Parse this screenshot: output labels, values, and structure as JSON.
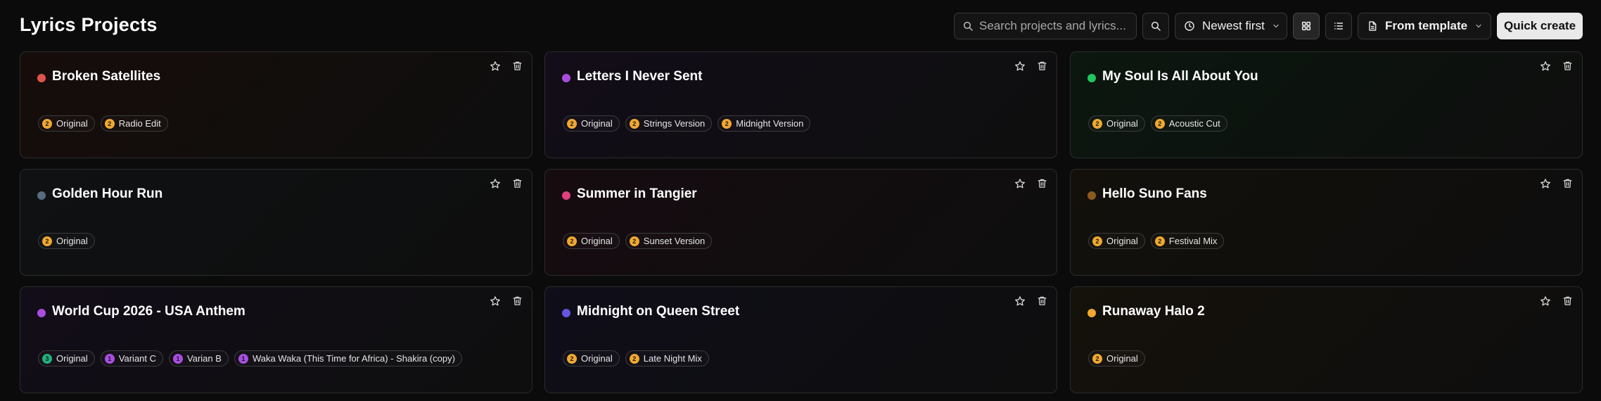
{
  "header": {
    "title": "Lyrics Projects",
    "search_placeholder": "Search projects and lyrics...",
    "search_icon": "search-icon",
    "search_button_icon": "search-icon",
    "sort_label": "Newest first",
    "sort_icon": "clock-icon",
    "view_grid_icon": "grid-icon",
    "view_list_icon": "list-icon",
    "view_mode": "grid",
    "template_label": "From template",
    "template_icon": "document-icon",
    "quick_create_label": "Quick create"
  },
  "colors": {
    "background": "#0b0b0b",
    "quick_create_bg": "#e9e9e9",
    "version_count_default": "#f0a830"
  },
  "projects": [
    {
      "title": "Broken Satellites",
      "dot_color": "#e0534d",
      "tint": "#160d0b",
      "versions": [
        {
          "label": "Original",
          "count": "2",
          "color": "#f0a830"
        },
        {
          "label": "Radio Edit",
          "count": "2",
          "color": "#f0a830"
        }
      ]
    },
    {
      "title": "Letters I Never Sent",
      "dot_color": "#a94de0",
      "tint": "#120d18",
      "versions": [
        {
          "label": "Original",
          "count": "2",
          "color": "#f0a830"
        },
        {
          "label": "Strings Version",
          "count": "2",
          "color": "#f0a830"
        },
        {
          "label": "Midnight Version",
          "count": "2",
          "color": "#f0a830"
        }
      ]
    },
    {
      "title": "My Soul Is All About You",
      "dot_color": "#22c55e",
      "tint": "#0b170f",
      "versions": [
        {
          "label": "Original",
          "count": "2",
          "color": "#f0a830"
        },
        {
          "label": "Acoustic Cut",
          "count": "2",
          "color": "#f0a830"
        }
      ]
    },
    {
      "title": "Golden Hour Run",
      "dot_color": "#5a6b7d",
      "tint": "#0f1113",
      "versions": [
        {
          "label": "Original",
          "count": "2",
          "color": "#f0a830"
        }
      ]
    },
    {
      "title": "Summer in Tangier",
      "dot_color": "#e0407f",
      "tint": "#160c10",
      "versions": [
        {
          "label": "Original",
          "count": "2",
          "color": "#f0a830"
        },
        {
          "label": "Sunset Version",
          "count": "2",
          "color": "#f0a830"
        }
      ]
    },
    {
      "title": "Hello Suno Fans",
      "dot_color": "#8b5a1e",
      "tint": "#13100b",
      "versions": [
        {
          "label": "Original",
          "count": "2",
          "color": "#f0a830"
        },
        {
          "label": "Festival Mix",
          "count": "2",
          "color": "#f0a830"
        }
      ]
    },
    {
      "title": "World Cup 2026 - USA Anthem",
      "dot_color": "#a94de0",
      "tint": "#120d18",
      "versions": [
        {
          "label": "Original",
          "count": "3",
          "color": "#22b07d"
        },
        {
          "label": "Variant C",
          "count": "1",
          "color": "#a94de0"
        },
        {
          "label": "Varian B",
          "count": "1",
          "color": "#a94de0"
        },
        {
          "label": "Waka Waka (This Time for Africa) - Shakira (copy)",
          "count": "1",
          "color": "#a94de0"
        }
      ]
    },
    {
      "title": "Midnight on Queen Street",
      "dot_color": "#6655e0",
      "tint": "#0f0e19",
      "versions": [
        {
          "label": "Original",
          "count": "2",
          "color": "#f0a830"
        },
        {
          "label": "Late Night Mix",
          "count": "2",
          "color": "#f0a830"
        }
      ]
    },
    {
      "title": "Runaway Halo 2",
      "dot_color": "#f0a830",
      "tint": "#15110b",
      "versions": [
        {
          "label": "Original",
          "count": "2",
          "color": "#f0a830"
        }
      ]
    }
  ]
}
